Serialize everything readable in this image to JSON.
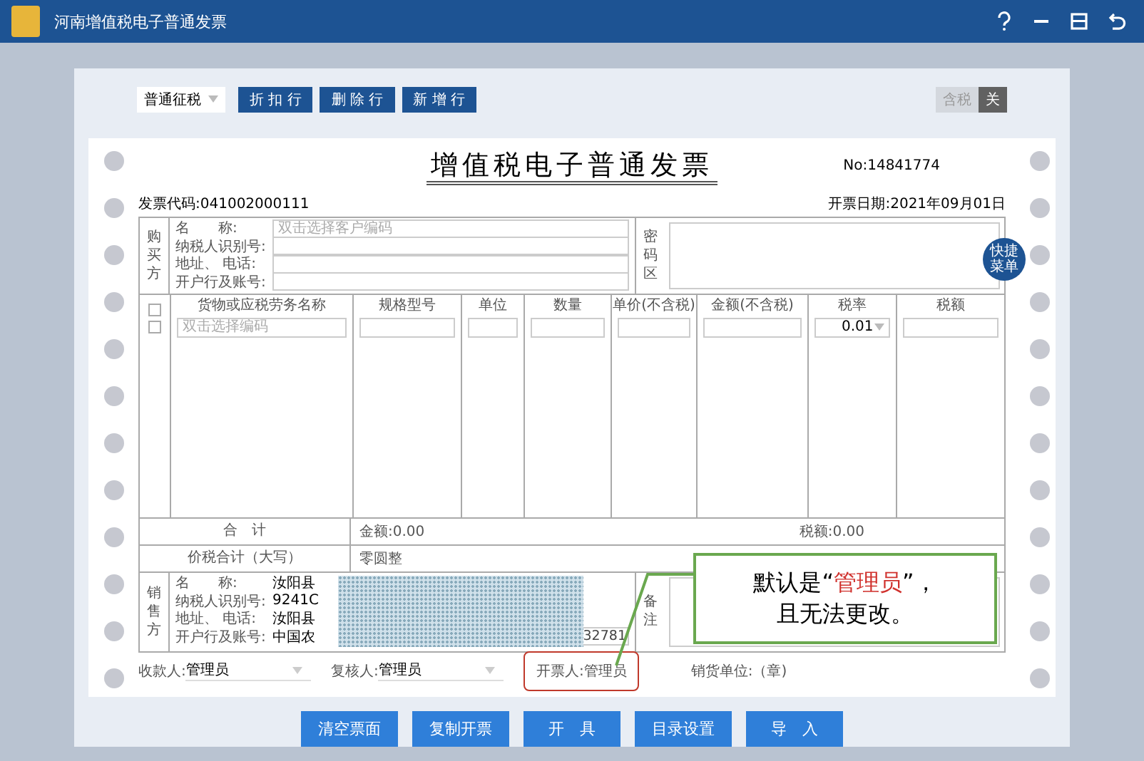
{
  "window": {
    "title": "河南增值税电子普通发票"
  },
  "toolbar": {
    "tax_type": "普通征税",
    "buttons": [
      "折 扣 行",
      "删 除 行",
      "新 增 行"
    ],
    "tax_toggle": [
      {
        "label": "含税",
        "selected": false
      },
      {
        "label": "关",
        "selected": true
      }
    ]
  },
  "invoice": {
    "title": "增值税电子普通发票",
    "number": "No:14841774",
    "code": "发票代码:041002000111",
    "date": "开票日期:2021年09月01日",
    "buyer": {
      "side_label": "购买方",
      "fields": [
        {
          "label": "名　　称:",
          "placeholder": "双击选择客户编码"
        },
        {
          "label": "纳税人识别号:"
        },
        {
          "label": "地址、 电话:"
        },
        {
          "label": "开户行及账号:"
        }
      ],
      "cipher_label": "密码区"
    },
    "quick_menu": "快捷菜单",
    "items": {
      "columns": [
        "货物或应税劳务名称",
        "规格型号",
        "单位",
        "数量",
        "单价(不含税)",
        "金额(不含税)",
        "税率",
        "税额"
      ],
      "header_checked": false,
      "rows": [
        {
          "checked": false,
          "name_placeholder": "双击选择编码",
          "tax_rate": "0.01"
        }
      ]
    },
    "totals": {
      "label": "合　计",
      "amount": "金额:0.00",
      "tax": "税额:0.00"
    },
    "grand_total": {
      "label": "价税合计（大写）",
      "value": "零圆整"
    },
    "seller": {
      "side_label": "销售方",
      "fields": [
        {
          "label": "名　　称:",
          "value": "汝阳县"
        },
        {
          "label": "纳税人识别号:",
          "value": "9241C"
        },
        {
          "label": "地址、 电话:",
          "value": "汝阳县"
        },
        {
          "label": "开户行及账号:",
          "value": "中国农",
          "value_end": "32781"
        }
      ],
      "remarks_label": "备注"
    },
    "signatures": [
      {
        "kind": "dropdown",
        "label": "收款人:",
        "value": "管理员",
        "highlighted": false
      },
      {
        "kind": "dropdown",
        "label": "复核人:",
        "value": "管理员",
        "highlighted": false
      },
      {
        "kind": "text",
        "label": "开票人:管理员",
        "highlighted": true
      },
      {
        "kind": "text",
        "label": "销货单位:（章)",
        "highlighted": false
      }
    ]
  },
  "actions": [
    "清空票面",
    "复制开票",
    "开　具",
    "目录设置",
    "导　入"
  ],
  "callout": {
    "before": "默认是“",
    "highlight": "管理员",
    "after": "”，",
    "line2": "且无法更改。"
  }
}
